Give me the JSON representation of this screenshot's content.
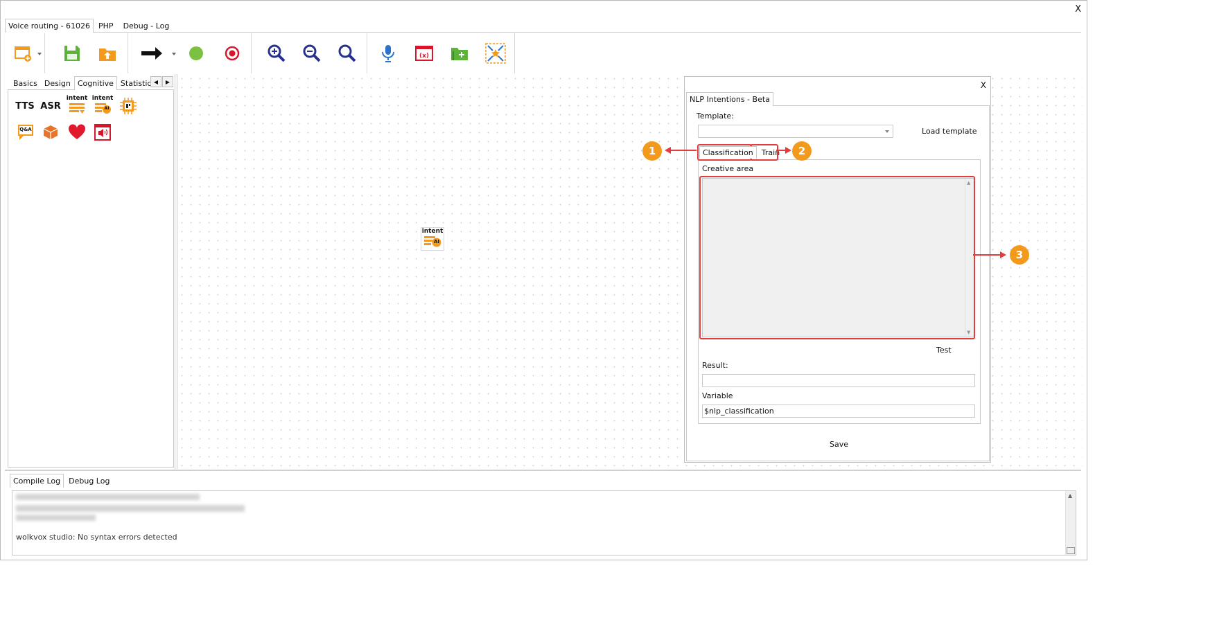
{
  "window": {
    "close_label": "X",
    "tabs": [
      "Voice routing - 61026",
      "PHP",
      "Debug - Log"
    ]
  },
  "toolbar": {
    "icons": [
      "new-flow-icon",
      "save-icon",
      "upload-icon",
      "connector-arrow-icon",
      "start-node-icon",
      "end-node-icon",
      "zoom-in-icon",
      "zoom-out-icon",
      "zoom-fit-icon",
      "microphone-icon",
      "variables-icon",
      "add-folder-icon",
      "expand-icon"
    ],
    "colors": {
      "save": "#5cb23b",
      "upload": "#f39a1d",
      "start": "#7cc242",
      "end": "#d6172a",
      "zoom": "#27318c",
      "mic": "#2b72c9",
      "variables": "#d6172a"
    }
  },
  "palette": {
    "tabs": [
      "Basics",
      "Design",
      "Cognitive",
      "Statistics"
    ],
    "active_tab": "Cognitive",
    "items": [
      "TTS",
      "ASR",
      "intent",
      "intent",
      "Q&A"
    ],
    "ai_label": "AI"
  },
  "canvas": {
    "node_label": "intent",
    "node_ai_label": "AI"
  },
  "nlp_panel": {
    "close_label": "X",
    "tab_title": "NLP Intentions - Beta",
    "template_label": "Template:",
    "template_value": "",
    "load_template": "Load template",
    "tabs": [
      "Classification",
      "Train"
    ],
    "creative_area_label": "Creative area",
    "creative_area_value": "",
    "test_button": "Test",
    "result_label": "Result:",
    "result_value": "",
    "variable_label": "Variable",
    "variable_value": "$nlp_classification",
    "save_button": "Save"
  },
  "callouts": [
    "1",
    "2",
    "3"
  ],
  "log": {
    "tabs": [
      "Compile Log",
      "Debug Log"
    ],
    "message": "wolkvox studio: No syntax errors detected"
  }
}
